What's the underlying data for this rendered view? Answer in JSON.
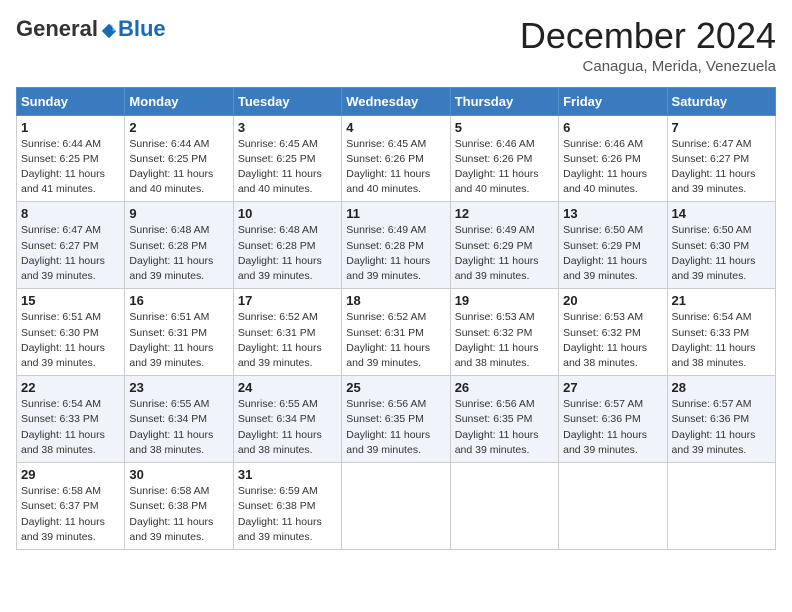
{
  "header": {
    "logo_general": "General",
    "logo_blue": "Blue",
    "month_title": "December 2024",
    "location": "Canagua, Merida, Venezuela"
  },
  "days_of_week": [
    "Sunday",
    "Monday",
    "Tuesday",
    "Wednesday",
    "Thursday",
    "Friday",
    "Saturday"
  ],
  "weeks": [
    [
      {
        "day": "1",
        "info": "Sunrise: 6:44 AM\nSunset: 6:25 PM\nDaylight: 11 hours\nand 41 minutes."
      },
      {
        "day": "2",
        "info": "Sunrise: 6:44 AM\nSunset: 6:25 PM\nDaylight: 11 hours\nand 40 minutes."
      },
      {
        "day": "3",
        "info": "Sunrise: 6:45 AM\nSunset: 6:25 PM\nDaylight: 11 hours\nand 40 minutes."
      },
      {
        "day": "4",
        "info": "Sunrise: 6:45 AM\nSunset: 6:26 PM\nDaylight: 11 hours\nand 40 minutes."
      },
      {
        "day": "5",
        "info": "Sunrise: 6:46 AM\nSunset: 6:26 PM\nDaylight: 11 hours\nand 40 minutes."
      },
      {
        "day": "6",
        "info": "Sunrise: 6:46 AM\nSunset: 6:26 PM\nDaylight: 11 hours\nand 40 minutes."
      },
      {
        "day": "7",
        "info": "Sunrise: 6:47 AM\nSunset: 6:27 PM\nDaylight: 11 hours\nand 39 minutes."
      }
    ],
    [
      {
        "day": "8",
        "info": "Sunrise: 6:47 AM\nSunset: 6:27 PM\nDaylight: 11 hours\nand 39 minutes."
      },
      {
        "day": "9",
        "info": "Sunrise: 6:48 AM\nSunset: 6:28 PM\nDaylight: 11 hours\nand 39 minutes."
      },
      {
        "day": "10",
        "info": "Sunrise: 6:48 AM\nSunset: 6:28 PM\nDaylight: 11 hours\nand 39 minutes."
      },
      {
        "day": "11",
        "info": "Sunrise: 6:49 AM\nSunset: 6:28 PM\nDaylight: 11 hours\nand 39 minutes."
      },
      {
        "day": "12",
        "info": "Sunrise: 6:49 AM\nSunset: 6:29 PM\nDaylight: 11 hours\nand 39 minutes."
      },
      {
        "day": "13",
        "info": "Sunrise: 6:50 AM\nSunset: 6:29 PM\nDaylight: 11 hours\nand 39 minutes."
      },
      {
        "day": "14",
        "info": "Sunrise: 6:50 AM\nSunset: 6:30 PM\nDaylight: 11 hours\nand 39 minutes."
      }
    ],
    [
      {
        "day": "15",
        "info": "Sunrise: 6:51 AM\nSunset: 6:30 PM\nDaylight: 11 hours\nand 39 minutes."
      },
      {
        "day": "16",
        "info": "Sunrise: 6:51 AM\nSunset: 6:31 PM\nDaylight: 11 hours\nand 39 minutes."
      },
      {
        "day": "17",
        "info": "Sunrise: 6:52 AM\nSunset: 6:31 PM\nDaylight: 11 hours\nand 39 minutes."
      },
      {
        "day": "18",
        "info": "Sunrise: 6:52 AM\nSunset: 6:31 PM\nDaylight: 11 hours\nand 39 minutes."
      },
      {
        "day": "19",
        "info": "Sunrise: 6:53 AM\nSunset: 6:32 PM\nDaylight: 11 hours\nand 38 minutes."
      },
      {
        "day": "20",
        "info": "Sunrise: 6:53 AM\nSunset: 6:32 PM\nDaylight: 11 hours\nand 38 minutes."
      },
      {
        "day": "21",
        "info": "Sunrise: 6:54 AM\nSunset: 6:33 PM\nDaylight: 11 hours\nand 38 minutes."
      }
    ],
    [
      {
        "day": "22",
        "info": "Sunrise: 6:54 AM\nSunset: 6:33 PM\nDaylight: 11 hours\nand 38 minutes."
      },
      {
        "day": "23",
        "info": "Sunrise: 6:55 AM\nSunset: 6:34 PM\nDaylight: 11 hours\nand 38 minutes."
      },
      {
        "day": "24",
        "info": "Sunrise: 6:55 AM\nSunset: 6:34 PM\nDaylight: 11 hours\nand 38 minutes."
      },
      {
        "day": "25",
        "info": "Sunrise: 6:56 AM\nSunset: 6:35 PM\nDaylight: 11 hours\nand 39 minutes."
      },
      {
        "day": "26",
        "info": "Sunrise: 6:56 AM\nSunset: 6:35 PM\nDaylight: 11 hours\nand 39 minutes."
      },
      {
        "day": "27",
        "info": "Sunrise: 6:57 AM\nSunset: 6:36 PM\nDaylight: 11 hours\nand 39 minutes."
      },
      {
        "day": "28",
        "info": "Sunrise: 6:57 AM\nSunset: 6:36 PM\nDaylight: 11 hours\nand 39 minutes."
      }
    ],
    [
      {
        "day": "29",
        "info": "Sunrise: 6:58 AM\nSunset: 6:37 PM\nDaylight: 11 hours\nand 39 minutes."
      },
      {
        "day": "30",
        "info": "Sunrise: 6:58 AM\nSunset: 6:38 PM\nDaylight: 11 hours\nand 39 minutes."
      },
      {
        "day": "31",
        "info": "Sunrise: 6:59 AM\nSunset: 6:38 PM\nDaylight: 11 hours\nand 39 minutes."
      },
      null,
      null,
      null,
      null
    ]
  ]
}
